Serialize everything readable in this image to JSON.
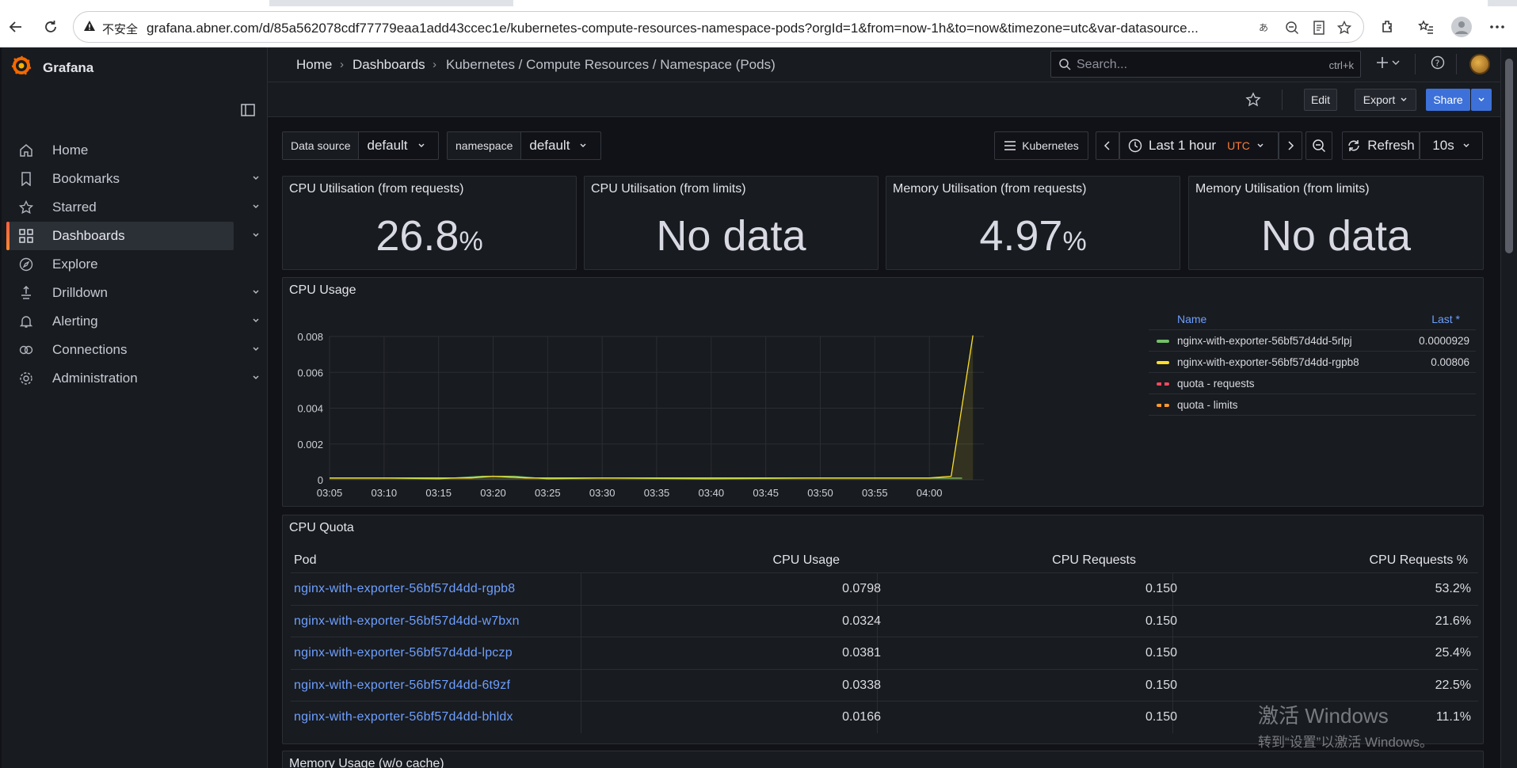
{
  "browser": {
    "insecure_label": "不安全",
    "url": "grafana.abner.com/d/85a562078cdf77779eaa1add43ccec1e/kubernetes-compute-resources-namespace-pods?orgId=1&from=now-1h&to=now&timezone=utc&var-datasource..."
  },
  "sidebar": {
    "brand": "Grafana",
    "items": [
      {
        "label": "Home",
        "icon": "home-icon",
        "chevron": false
      },
      {
        "label": "Bookmarks",
        "icon": "bookmark-icon",
        "chevron": true
      },
      {
        "label": "Starred",
        "icon": "star-icon",
        "chevron": true
      },
      {
        "label": "Dashboards",
        "icon": "apps-icon",
        "chevron": true,
        "active": true
      },
      {
        "label": "Explore",
        "icon": "compass-icon",
        "chevron": false
      },
      {
        "label": "Drilldown",
        "icon": "drilldown-icon",
        "chevron": true
      },
      {
        "label": "Alerting",
        "icon": "bell-icon",
        "chevron": true
      },
      {
        "label": "Connections",
        "icon": "connections-icon",
        "chevron": true
      },
      {
        "label": "Administration",
        "icon": "cog-icon",
        "chevron": true
      }
    ]
  },
  "topbar": {
    "breadcrumb": [
      "Home",
      "Dashboards",
      "Kubernetes / Compute Resources / Namespace (Pods)"
    ],
    "search_placeholder": "Search...",
    "search_shortcut": "ctrl+k"
  },
  "toolbar": {
    "edit": "Edit",
    "export": "Export",
    "share": "Share"
  },
  "variables": [
    {
      "label": "Data source",
      "value": "default"
    },
    {
      "label": "namespace",
      "value": "default"
    }
  ],
  "controls": {
    "kubernetes_link": "Kubernetes",
    "time_range": "Last 1 hour",
    "timezone": "UTC",
    "refresh": "Refresh",
    "refresh_interval": "10s"
  },
  "stats": [
    {
      "title": "CPU Utilisation (from requests)",
      "value": "26.8",
      "unit": "%"
    },
    {
      "title": "CPU Utilisation (from limits)",
      "value": "No data",
      "unit": ""
    },
    {
      "title": "Memory Utilisation (from requests)",
      "value": "4.97",
      "unit": "%"
    },
    {
      "title": "Memory Utilisation (from limits)",
      "value": "No data",
      "unit": ""
    }
  ],
  "cpu_usage": {
    "title": "CPU Usage",
    "legend_header": {
      "name": "Name",
      "last": "Last *"
    },
    "legend": [
      {
        "name": "nginx-with-exporter-56bf57d4dd-5rlpj",
        "last": "0.0000929",
        "color": "#73bf69",
        "dashed": false
      },
      {
        "name": "nginx-with-exporter-56bf57d4dd-rgpb8",
        "last": "0.00806",
        "color": "#fade2a",
        "dashed": false
      },
      {
        "name": "quota - requests",
        "last": "",
        "color": "#f2495c",
        "dashed": true
      },
      {
        "name": "quota - limits",
        "last": "",
        "color": "#ff9830",
        "dashed": true
      }
    ]
  },
  "chart_data": {
    "type": "line",
    "title": "CPU Usage",
    "x": [
      "03:05",
      "03:10",
      "03:15",
      "03:20",
      "03:25",
      "03:30",
      "03:35",
      "03:40",
      "03:45",
      "03:50",
      "03:55",
      "04:00"
    ],
    "ylim": [
      0,
      0.008
    ],
    "yticks": [
      "0.008",
      "0.006",
      "0.004",
      "0.002",
      "0"
    ],
    "grid": true,
    "legend_position": "right",
    "series": [
      {
        "name": "nginx-with-exporter-56bf57d4dd-5rlpj",
        "color": "#73bf69",
        "points": [
          [
            "03:05",
            0.0001
          ],
          [
            "03:10",
            0.0001
          ],
          [
            "03:15",
            5e-05
          ],
          [
            "03:19",
            0.0002
          ],
          [
            "03:22",
            0.0002
          ],
          [
            "03:25",
            5e-05
          ],
          [
            "03:30",
            0.0001
          ],
          [
            "03:40",
            5e-05
          ],
          [
            "03:50",
            0.0001
          ],
          [
            "04:03",
            9.29e-05
          ]
        ]
      },
      {
        "name": "nginx-with-exporter-56bf57d4dd-rgpb8",
        "color": "#fade2a",
        "points": [
          [
            "03:05",
            0.0001
          ],
          [
            "03:18",
            0.0001
          ],
          [
            "03:20",
            0.0002
          ],
          [
            "03:23",
            0.0001
          ],
          [
            "03:40",
            0.0001
          ],
          [
            "03:50",
            0.0001
          ],
          [
            "04:00",
            0.0001
          ],
          [
            "04:02",
            0.0002
          ],
          [
            "04:04",
            0.00806
          ]
        ]
      }
    ]
  },
  "cpu_quota": {
    "title": "CPU Quota",
    "columns": [
      "Pod",
      "CPU Usage",
      "CPU Requests",
      "CPU Requests %"
    ],
    "rows": [
      [
        "nginx-with-exporter-56bf57d4dd-rgpb8",
        "0.0798",
        "0.150",
        "53.2%"
      ],
      [
        "nginx-with-exporter-56bf57d4dd-w7bxn",
        "0.0324",
        "0.150",
        "21.6%"
      ],
      [
        "nginx-with-exporter-56bf57d4dd-lpczp",
        "0.0381",
        "0.150",
        "25.4%"
      ],
      [
        "nginx-with-exporter-56bf57d4dd-6t9zf",
        "0.0338",
        "0.150",
        "22.5%"
      ],
      [
        "nginx-with-exporter-56bf57d4dd-bhldx",
        "0.0166",
        "0.150",
        "11.1%"
      ]
    ]
  },
  "next_panel_title": "Memory Usage (w/o cache)",
  "watermark": {
    "line1": "激活 Windows",
    "line2": "转到“设置”以激活 Windows。"
  }
}
